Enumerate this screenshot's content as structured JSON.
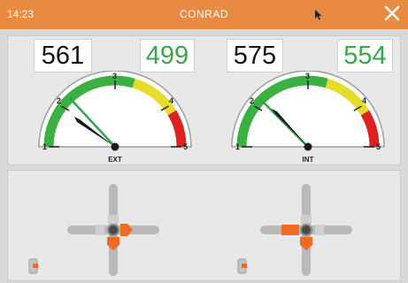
{
  "window": {
    "time": "14:23",
    "title": "CONRAD"
  },
  "colors": {
    "titlebar": "#e98a43",
    "gauge_green": "#3cb043",
    "gauge_yellow": "#e6dd2a",
    "gauge_red": "#dd2020",
    "joystick_orange": "#f06a22",
    "needle_green": "#2aa84a"
  },
  "gauges": [
    {
      "label": "EXT",
      "reading": "561",
      "target": "499",
      "ticks": [
        "1",
        "2",
        "3",
        "4",
        "5"
      ]
    },
    {
      "label": "INT",
      "reading": "575",
      "target": "554",
      "ticks": [
        "1",
        "2",
        "3",
        "4",
        "5"
      ]
    }
  ],
  "joysticks": [
    {
      "name": "left-joystick",
      "active": [
        "right",
        "down"
      ]
    },
    {
      "name": "right-joystick",
      "active": [
        "left",
        "down"
      ]
    }
  ]
}
